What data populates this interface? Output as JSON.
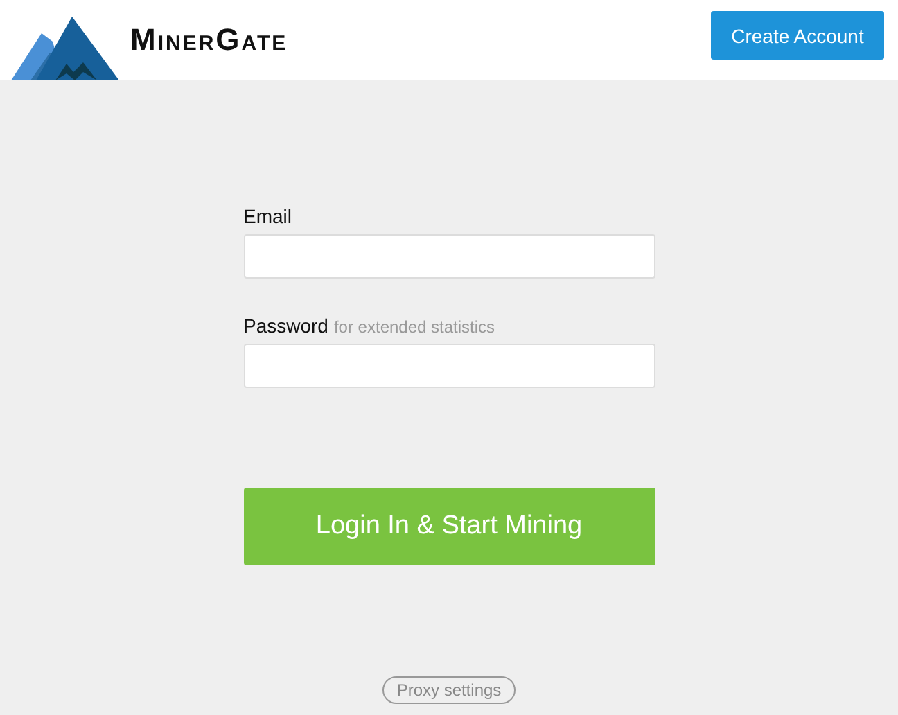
{
  "header": {
    "logo_text": "MinerGate",
    "create_account": "Create Account"
  },
  "form": {
    "email_label": "Email",
    "password_label": "Password",
    "password_hint": "for extended statistics",
    "submit": "Login In & Start Mining"
  },
  "proxy_settings": "Proxy settings"
}
